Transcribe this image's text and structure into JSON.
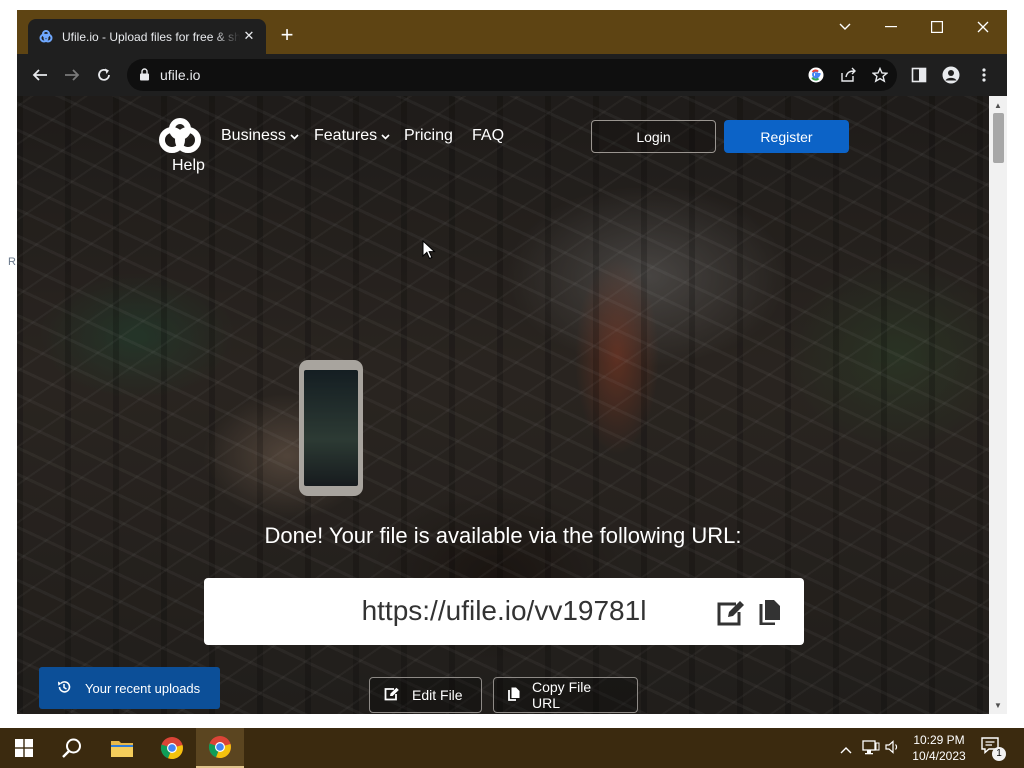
{
  "desktop": {
    "edge_glyph": "R"
  },
  "browser": {
    "tab": {
      "title": "Ufile.io - Upload files for free & share"
    },
    "address_bar": {
      "url": "ufile.io"
    }
  },
  "site": {
    "nav": {
      "help": "Help",
      "business": "Business",
      "features": "Features",
      "pricing": "Pricing",
      "faq": "FAQ",
      "login": "Login",
      "register": "Register"
    },
    "result": {
      "message_prefix": "Done! Your file is available via ",
      "message_highlight": "the following URL",
      "message_suffix": ":",
      "file_url": "https://ufile.io/vv19781l"
    },
    "actions": {
      "edit_file": "Edit File",
      "copy_file_url": "Copy File URL"
    },
    "recent_uploads": "Your recent uploads"
  },
  "taskbar": {
    "time": "10:29 PM",
    "date": "10/4/2023",
    "notification_count": "1"
  },
  "colors": {
    "register_blue": "#0c63c7",
    "recent_blue": "#0c4f98",
    "chrome_frame": "#5e4413",
    "taskbar": "#3b2a0f"
  }
}
